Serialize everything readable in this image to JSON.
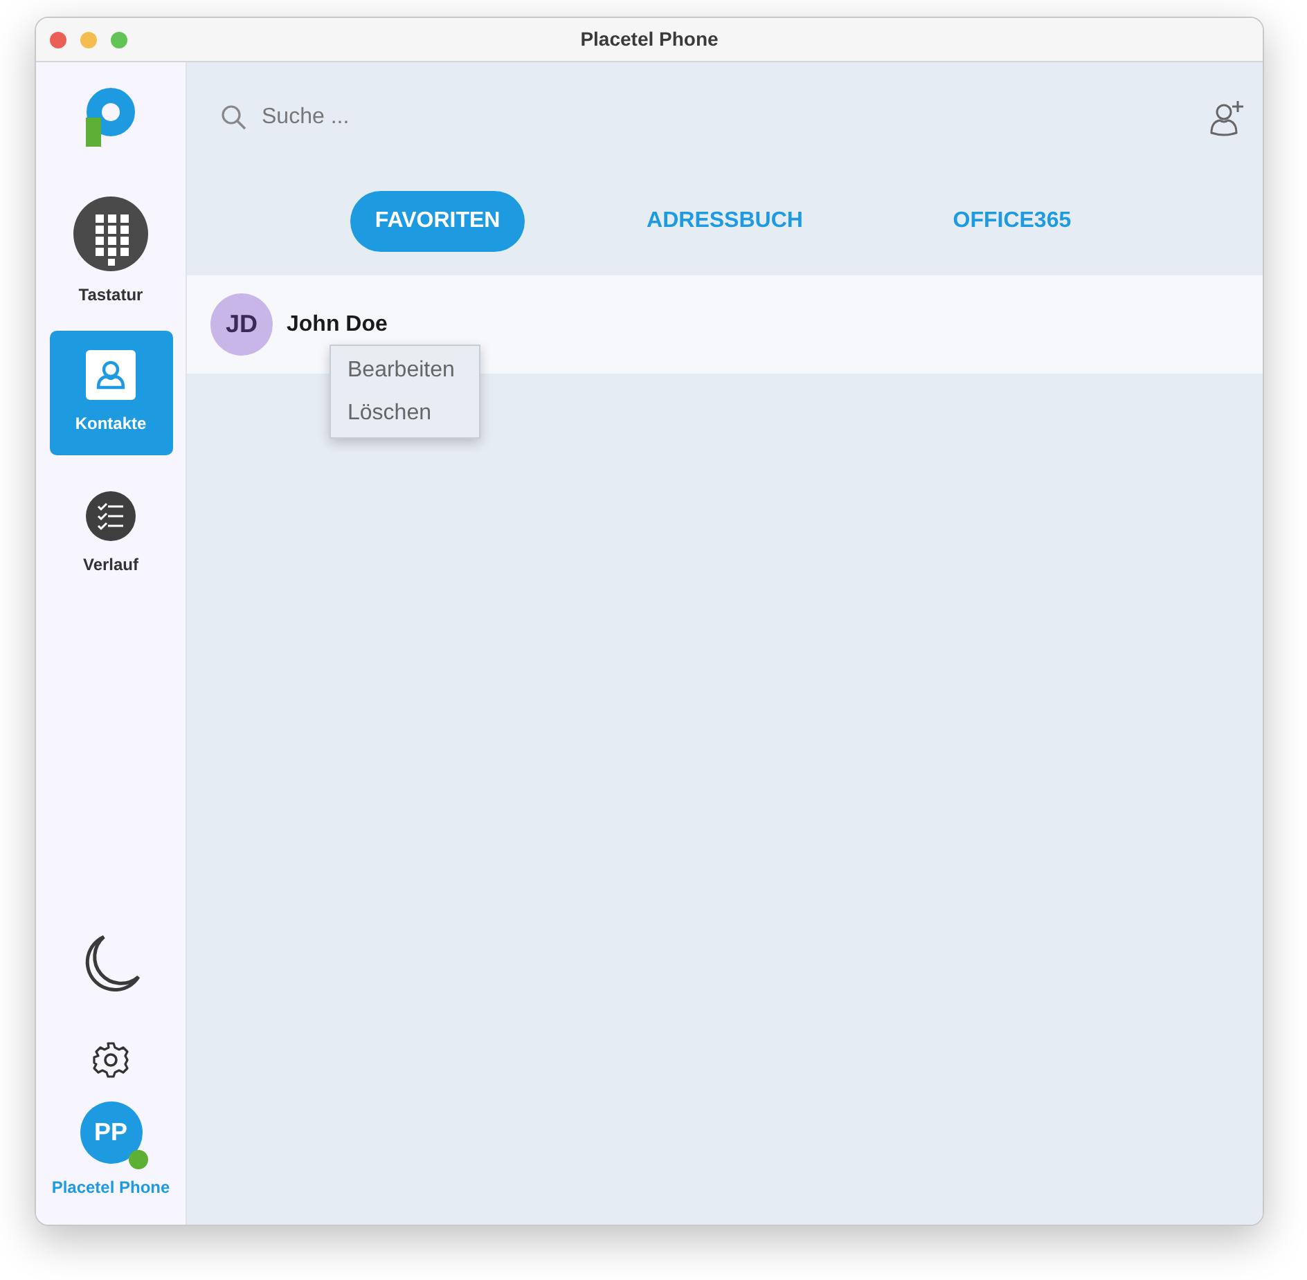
{
  "window": {
    "title": "Placetel Phone"
  },
  "sidebar": {
    "items": [
      {
        "kind": "keypad",
        "label": "Tastatur",
        "selected": false
      },
      {
        "kind": "contacts",
        "label": "Kontakte",
        "selected": true
      },
      {
        "kind": "history",
        "label": "Verlauf",
        "selected": false
      }
    ],
    "user": {
      "initials": "PP",
      "name": "Placetel Phone",
      "online": true
    }
  },
  "search": {
    "placeholder": "Suche ..."
  },
  "tabs": [
    {
      "label": "FAVORITEN",
      "selected": true
    },
    {
      "label": "ADRESSBUCH",
      "selected": false
    },
    {
      "label": "OFFICE365",
      "selected": false
    }
  ],
  "contacts": [
    {
      "initials": "JD",
      "name": "John Doe",
      "color": "#c9b6e8"
    }
  ],
  "context_menu": {
    "items": [
      "Bearbeiten",
      "Löschen"
    ]
  }
}
